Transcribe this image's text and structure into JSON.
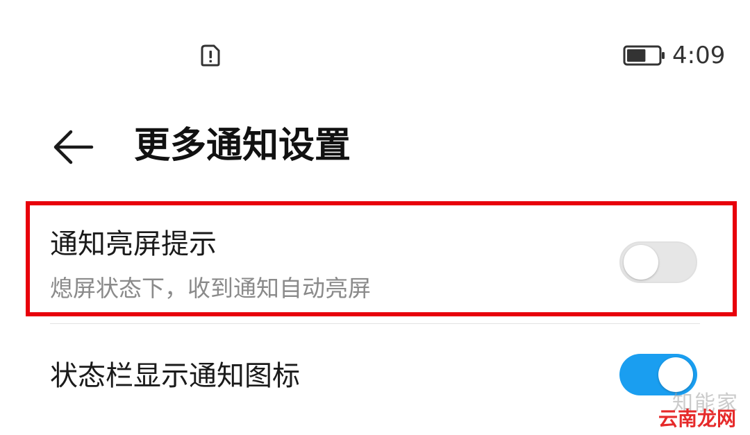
{
  "status_bar": {
    "sim_icon": "sim-alert-icon",
    "battery_icon": "battery-icon",
    "battery_level_fraction": 0.6,
    "time": "4:09"
  },
  "header": {
    "back_icon": "back-arrow-icon",
    "title": "更多通知设置"
  },
  "settings": [
    {
      "title": "通知亮屏提示",
      "subtitle": "熄屏状态下，收到通知自动亮屏",
      "enabled": false
    },
    {
      "title": "状态栏显示通知图标",
      "enabled": true
    }
  ],
  "colors": {
    "accent": "#1a9ef0",
    "highlight": "#e8000b"
  },
  "watermark": {
    "line1": "知能家",
    "line2": "云南龙网"
  }
}
